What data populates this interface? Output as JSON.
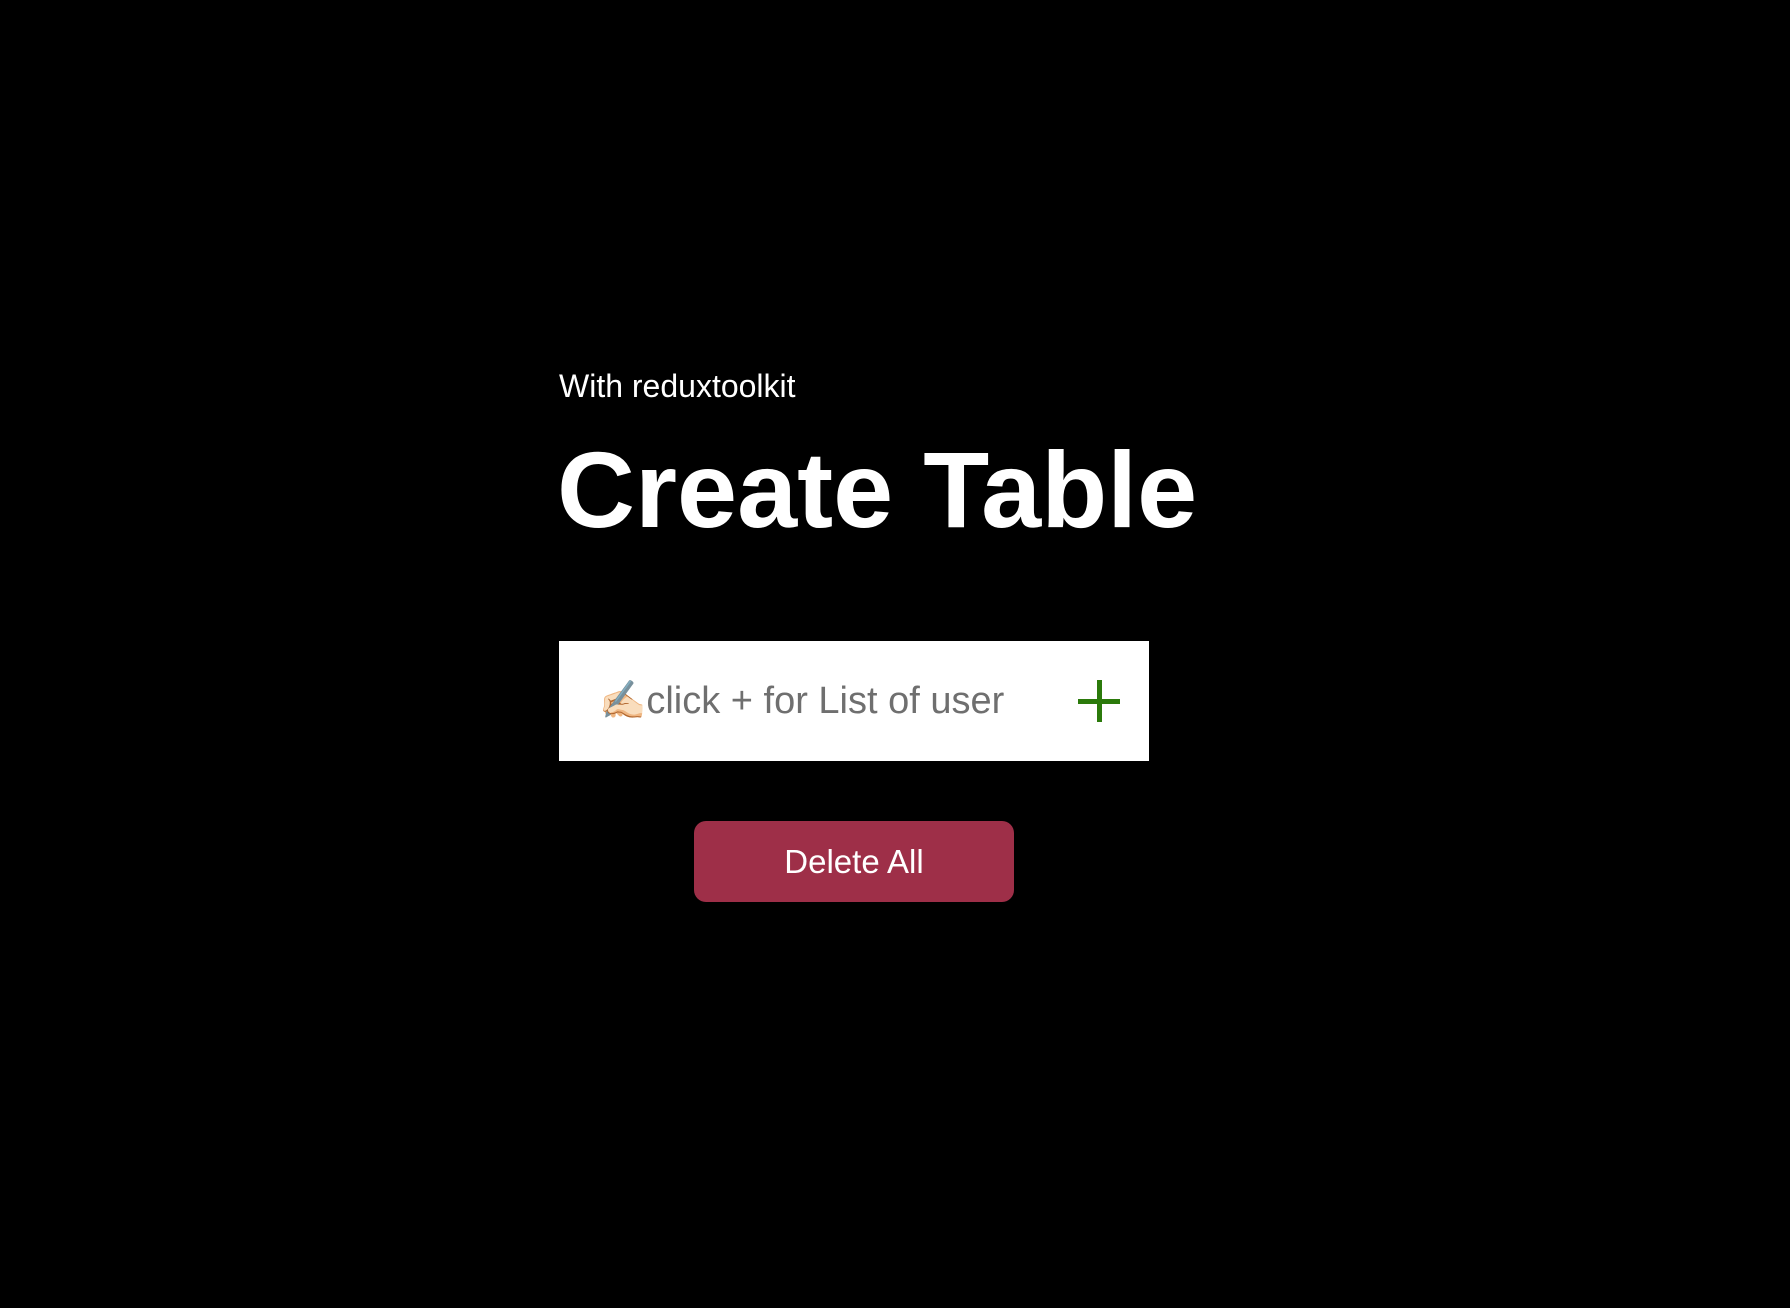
{
  "header": {
    "subtitle": "With reduxtoolkit",
    "title": "Create Table"
  },
  "form": {
    "input_placeholder": "✍🏻click + for List of user",
    "input_value": "",
    "add_icon": "plus-icon",
    "add_icon_color": "#2b7a0b"
  },
  "actions": {
    "delete_all_label": "Delete All",
    "delete_all_color": "#9e2f48"
  },
  "theme": {
    "background": "#000000",
    "text": "#ffffff"
  }
}
